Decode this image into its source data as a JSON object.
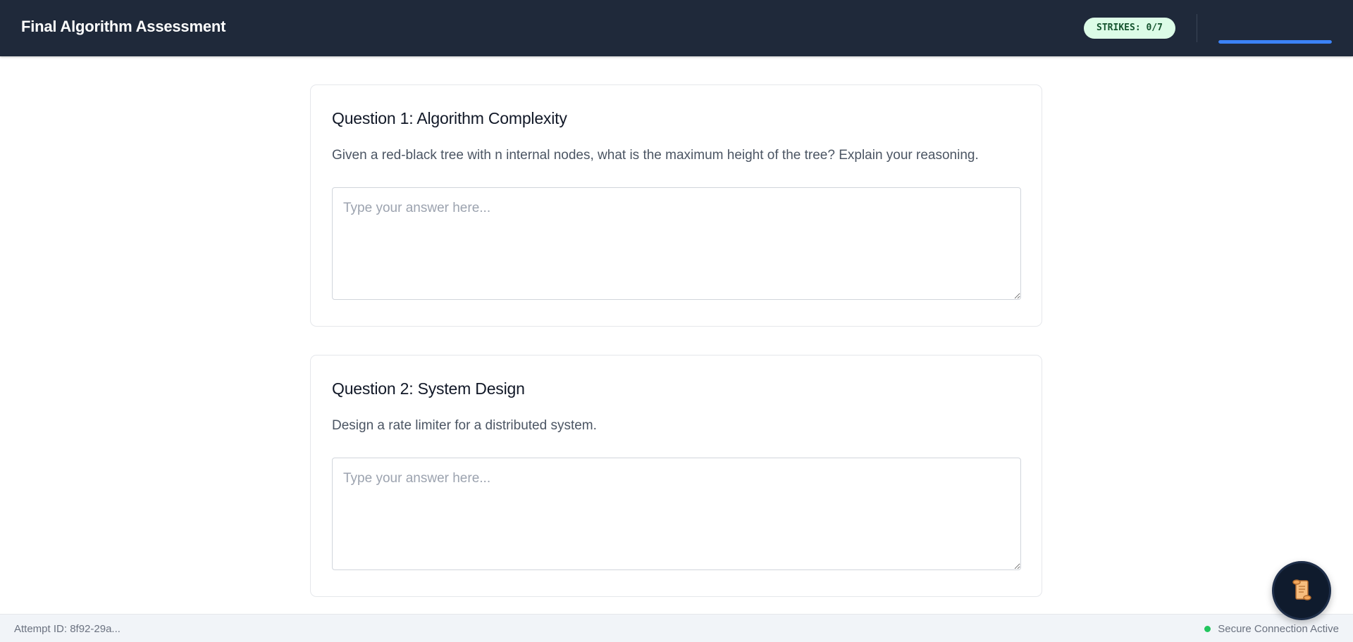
{
  "header": {
    "title": "Final Algorithm Assessment",
    "strikes_label": "STRIKES: 0/7",
    "progress_fraction": 1.0
  },
  "questions": [
    {
      "title": "Question 1: Algorithm Complexity",
      "text": "Given a red-black tree with n internal nodes, what is the maximum height of the tree? Explain your reasoning.",
      "answer_value": "",
      "answer_placeholder": "Type your answer here..."
    },
    {
      "title": "Question 2: System Design",
      "text": "Design a rate limiter for a distributed system.",
      "answer_value": "",
      "answer_placeholder": "Type your answer here..."
    }
  ],
  "footer": {
    "attempt_id": "Attempt ID: 8f92-29a...",
    "connection_status": "Secure Connection Active"
  },
  "fab": {
    "icon": "scroll-icon"
  },
  "colors": {
    "header_bg": "#1f293a",
    "badge_bg": "#dcfce7",
    "badge_text": "#14532d",
    "progress": "#3b82f6",
    "status_dot": "#22c55e",
    "footer_bg": "#f1f4f8",
    "fab_bg": "#0f1b2d",
    "scroll_fill": "#f6bd7e"
  }
}
